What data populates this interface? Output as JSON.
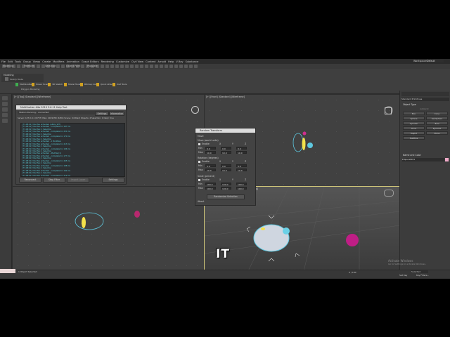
{
  "app": {
    "menu": [
      "File",
      "Edit",
      "Tools",
      "Group",
      "Views",
      "Create",
      "Modifiers",
      "Animation",
      "Graph Editors",
      "Rendering",
      "Customize",
      "Civil View",
      "Content",
      "Arnold",
      "Help",
      "V-Ray",
      "Substance"
    ],
    "workspace_label": "Workspaces:",
    "workspace_value": "Default"
  },
  "ribbon": {
    "tabs": [
      "Modeling",
      "Freeform",
      "Selection",
      "Object Paint",
      "Populate"
    ],
    "section_title": "Modeling",
    "sub_items": [
      "Modify Mode",
      "Polygon Modeling"
    ],
    "plugins": [
      "MultiScatter",
      "Power Scene",
      "3D Sketch",
      "Model Tools",
      "Bitmap Color",
      "Quick Attach",
      "Xref Tools"
    ]
  },
  "viewports": {
    "top_left_label": "[+] [Top] [Standard] [Wireframe]",
    "top_right_label": "[+] [Front] [Standard] [Wireframe]",
    "bottom_right_label": "[+] [Perspective] [Standard] [Default Shading]"
  },
  "logwin": {
    "title": "MultiScatter Alto 2019 3.6.11 Help Text",
    "status": "Station Running / connected",
    "buttons_top": [
      "Settings",
      "Information"
    ],
    "server_info": "Server: 127.0.0.1 (6757)  Max: 2019  PID: 6284 (Scene: Untitled)  Objects: 4  Selection: 1  Daily: true",
    "log": [
      "[Tv:08:01] 3ds Max Activated (ARGS_SET)",
      "[Tv:08:01] 3ds Max Activated - completed in 187 ms",
      "[Tv:08:01] 3ds Max: 1 Selection",
      "[Tv:08:01] 3ds Max Activated - completed in 231 ms",
      "[Tv:08:01] 3ds Max: 1 Selection",
      "[Tv:08:01] 3ds Max Activated - completed in 170 ms",
      "[Tv:08:01] 3ds Max: 1 Selection",
      "[Tv:08:01] 3ds Max Activated - 1 Modifiers",
      "[Tv:08:01] 3ds Max Activated - completed in 213 ms",
      "[Tv:08:01] 3ds Max: 1 Selection",
      "[Tv:08:01] 3ds Max Activated - completed in 196 ms",
      "[Tv:08:01] 3ds Max: 1 Selection",
      "[Tv:08:01] 3ds Max Activated - Modifier(1)",
      "[Tv:08:01] 3ds Max Activated - completed in 177 ms",
      "[Tv:08:01] 3ds Max: 1 Selection",
      "[Tv:08:01] 3ds Max Activated - completed in 205 ms",
      "[Tv:08:01] 3ds Max: 1 Selection",
      "[Tv:08:01] 3ds Max Activated - completed in 188 ms",
      "[Tv:08:01] 3ds Max: 1 Selection",
      "[Tv:08:01] 3ds Max Activated - completed in 192 ms",
      "[Tv:08:01] 3ds Max: 1 Selection",
      "[Tv:08:01] 3ds Max Activated - completed in 219 ms"
    ],
    "buttons_bottom": [
      "Reconnect",
      "Stop Filter",
      "Import Layer",
      "Settings"
    ]
  },
  "transform": {
    "title": "Random Transform",
    "move_group": "Move",
    "pos_title": "Move (world units)",
    "pos_enable": "Enable",
    "rot_title": "Rotation (degrees)",
    "rot_enable": "Enable",
    "scale_title": "Scale (percent)",
    "scale_enable": "Enable",
    "axes": [
      "X",
      "Y",
      "Z"
    ],
    "min_label": "Min",
    "max_label": "Max",
    "pos_min": [
      "0.0",
      "0.0",
      "0.0"
    ],
    "pos_max": [
      "10.0",
      "10.0",
      "10.0"
    ],
    "rot_min": [
      "0.0",
      "0.0",
      "0.0"
    ],
    "rot_max": [
      "10.0",
      "10.0",
      "10.0"
    ],
    "scale_min": [
      "100.0",
      "100.0",
      "100.0"
    ],
    "scale_max": [
      "100.0",
      "100.0",
      "100.0"
    ],
    "apply_button": "Randomize Selection",
    "about": "About"
  },
  "command_panel": {
    "dropdown": "Standard Primitives",
    "rollout_object_type": "Object Type",
    "autogrid": "AutoGrid",
    "buttons": [
      "Box",
      "Cone",
      "Sphere",
      "GeoSphere",
      "Cylinder",
      "Tube",
      "Torus",
      "Pyramid",
      "Teapot",
      "Plane",
      "TextPlus"
    ],
    "rollout_name": "Name and Color",
    "name_value": "Ellipsoid001"
  },
  "status": {
    "selection": "1 Object Selected",
    "activate_title": "Activate Windows",
    "activate_sub": "Go to Settings to activate Windows.",
    "frame": "0 / 100",
    "selected": "Selected",
    "setkey": "Set Key",
    "keyfilters": "Key Filters..."
  },
  "caption": "IT",
  "colors": {
    "ui_bg": "#444444",
    "viewport_bg": "#414141",
    "accent_cyan": "#5ec8e0",
    "accent_yellow": "#f2e14b",
    "accent_magenta": "#d02f8e",
    "log_text": "#59c8d2"
  }
}
